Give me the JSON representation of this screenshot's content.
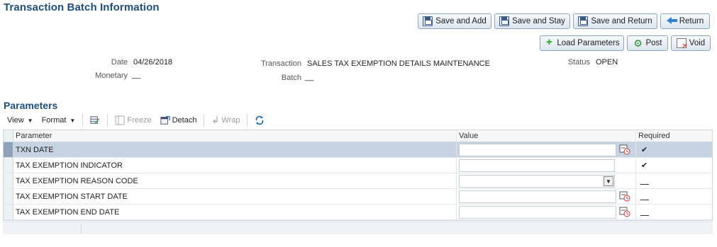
{
  "page": {
    "title": "Transaction Batch Information"
  },
  "actions": {
    "save_add": "Save and Add",
    "save_stay": "Save and Stay",
    "save_return": "Save and Return",
    "return": "Return",
    "load_parameters": "Load Parameters",
    "post": "Post",
    "void": "Void"
  },
  "info": {
    "date_label": "Date",
    "date_value": "04/26/2018",
    "monetary_label": "Monetary",
    "monetary_value": "__",
    "transaction_label": "Transaction",
    "transaction_value": "SALES TAX EXEMPTION DETAILS MAINTENANCE",
    "batch_label": "Batch",
    "batch_value": "__",
    "status_label": "Status",
    "status_value": "OPEN"
  },
  "parameters": {
    "title": "Parameters",
    "toolbar": {
      "view": "View",
      "format": "Format",
      "freeze": "Freeze",
      "detach": "Detach",
      "wrap": "Wrap"
    },
    "columns": [
      "Parameter",
      "Value",
      "Required"
    ],
    "rows": [
      {
        "parameter": "TXN DATE",
        "required": "✔"
      },
      {
        "parameter": "TAX EXEMPTION INDICATOR",
        "required": "✔"
      },
      {
        "parameter": "TAX EXEMPTION REASON CODE",
        "required": ""
      },
      {
        "parameter": "TAX EXEMPTION START DATE",
        "required": ""
      },
      {
        "parameter": "TAX EXEMPTION END DATE",
        "required": ""
      }
    ]
  },
  "colors": {
    "title": "#1f4e79",
    "selected_row": "#c6d3e3"
  }
}
